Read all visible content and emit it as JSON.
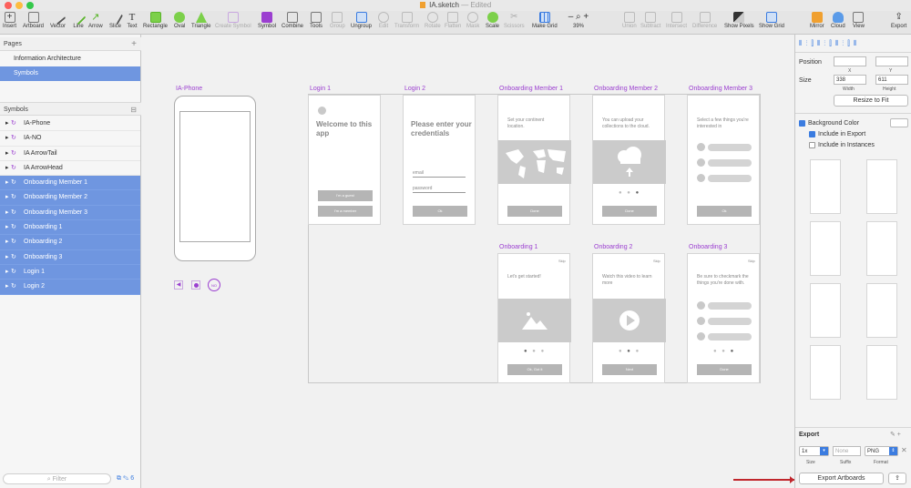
{
  "window": {
    "filename": "IA.sketch",
    "status": "— Edited"
  },
  "toolbar": {
    "items": [
      "Insert",
      "Artboard",
      "Vector",
      "Line",
      "Arrow",
      "Slice",
      "Text",
      "Rectangle",
      "Oval",
      "Triangle",
      "Create Symbol",
      "Symbol",
      "Combine",
      "Tools",
      "Group",
      "Ungroup",
      "Edit",
      "Transform",
      "Rotate",
      "Flatten",
      "Mask",
      "Scale",
      "Scissors",
      "Make Grid",
      "39%",
      "Union",
      "Subtract",
      "Intersect",
      "Difference",
      "Show Pixels",
      "Show Grid",
      "Mirror",
      "Cloud",
      "View",
      "Export"
    ]
  },
  "sidebar": {
    "pages_header": "Pages",
    "pages": [
      "Information Architecture",
      "Symbols"
    ],
    "symbols_header": "Symbols",
    "symbols": [
      {
        "label": "IA-Phone",
        "selected": false
      },
      {
        "label": "IA-NO",
        "selected": false
      },
      {
        "label": "IA ArrowTail",
        "selected": false
      },
      {
        "label": "IA ArrowHead",
        "selected": false
      },
      {
        "label": "Onboarding Member 1",
        "selected": true
      },
      {
        "label": "Onboarding Member 2",
        "selected": true
      },
      {
        "label": "Onboarding Member 3",
        "selected": true
      },
      {
        "label": "Onboarding 1",
        "selected": true
      },
      {
        "label": "Onboarding 2",
        "selected": true
      },
      {
        "label": "Onboarding 3",
        "selected": true
      },
      {
        "label": "Login 1",
        "selected": true
      },
      {
        "label": "Login 2",
        "selected": true
      }
    ],
    "filter_placeholder": "Filter",
    "counter": "6"
  },
  "canvas": {
    "artboards": {
      "phone": "IA-Phone",
      "login1": {
        "label": "Login 1",
        "title": "Welcome to this app",
        "btn1": "I'm a guest",
        "btn2": "I'm a member"
      },
      "login2": {
        "label": "Login 2",
        "title": "Please enter your credentials",
        "email": "email",
        "password": "password",
        "btn": "Ok"
      },
      "om1": {
        "label": "Onboarding Member 1",
        "text": "Set your continent location.",
        "btn": "Done"
      },
      "om2": {
        "label": "Onboarding Member 2",
        "text": "You can upload your collections to the cloud.",
        "btn": "Done"
      },
      "om3": {
        "label": "Onboarding Member 3",
        "text": "Select a few things you're interested in",
        "btn": "Ok"
      },
      "ob1": {
        "label": "Onboarding 1",
        "skip": "Skip",
        "text": "Let's get started!",
        "btn": "Ok, Got it"
      },
      "ob2": {
        "label": "Onboarding 2",
        "skip": "Skip",
        "text": "Watch this video to learn more",
        "btn": "Next"
      },
      "ob3": {
        "label": "Onboarding 3",
        "skip": "Skip",
        "text": "Be sure to checkmark the things you're done with.",
        "btn": "Done"
      }
    },
    "nav_no": "NO"
  },
  "inspector": {
    "position_label": "Position",
    "x_label": "X",
    "y_label": "Y",
    "size_label": "Size",
    "width": "338",
    "height": "611",
    "width_label": "Width",
    "height_label": "Height",
    "resize_btn": "Resize to Fit",
    "bg_color": "Background Color",
    "include_export": "Include in Export",
    "include_instances": "Include in Instances",
    "export_header": "Export",
    "scale": "1x",
    "suffix_placeholder": "None",
    "format": "PNG",
    "size_sub": "Size",
    "suffix_sub": "Suffix",
    "format_sub": "Format",
    "export_btn": "Export Artboards"
  },
  "colors": {
    "selection": "#6f96e0",
    "symbol": "#9b3fd0",
    "accent": "#3b7ce0",
    "annotation": "#c0262c"
  }
}
